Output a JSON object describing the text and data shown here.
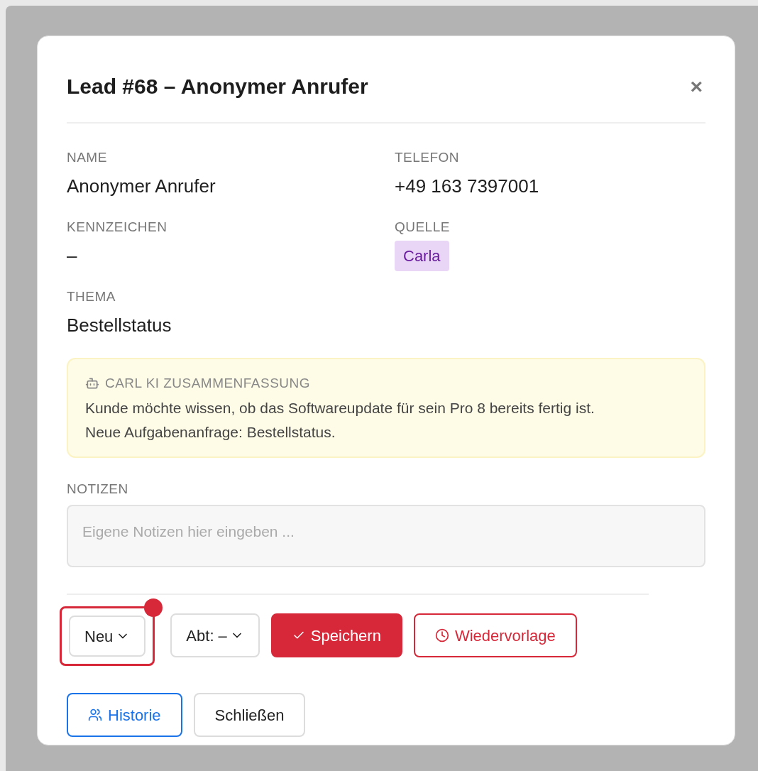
{
  "dialog": {
    "title": "Lead #68 – Anonymer Anrufer",
    "close": "×"
  },
  "fields": [
    {
      "label": "NAME",
      "value": "Anonymer Anrufer",
      "kind": "text"
    },
    {
      "label": "TELEFON",
      "value": "+49 163 7397001",
      "kind": "text"
    },
    {
      "label": "KENNZEICHEN",
      "value": "–",
      "kind": "text"
    },
    {
      "label": "QUELLE",
      "value": "Carla",
      "kind": "tag",
      "color": "#e9d5f5"
    },
    {
      "label": "THEMA",
      "value": "Bestellstatus",
      "kind": "text"
    }
  ],
  "summary": {
    "heading": "CARL KI ZUSAMMENFASSUNG",
    "lines": [
      "Kunde möchte wissen, ob das Softwareupdate für sein Pro 8 bereits fertig ist.",
      "Neue Aufgabenanfrage: Bestellstatus."
    ]
  },
  "notes": {
    "label": "NOTIZEN",
    "placeholder": "Eigene Notizen hier eingeben ..."
  },
  "status_select": {
    "value": "Neu",
    "highlighted": true
  },
  "department_select": {
    "value": "Abt: –"
  },
  "buttons": [
    {
      "label": "Speichern",
      "kind": "primary"
    },
    {
      "label": "Wiedervorlage",
      "kind": "outline-red"
    },
    {
      "label": "Historie",
      "kind": "outline-blue"
    },
    {
      "label": "Schließen",
      "kind": "plain"
    }
  ]
}
